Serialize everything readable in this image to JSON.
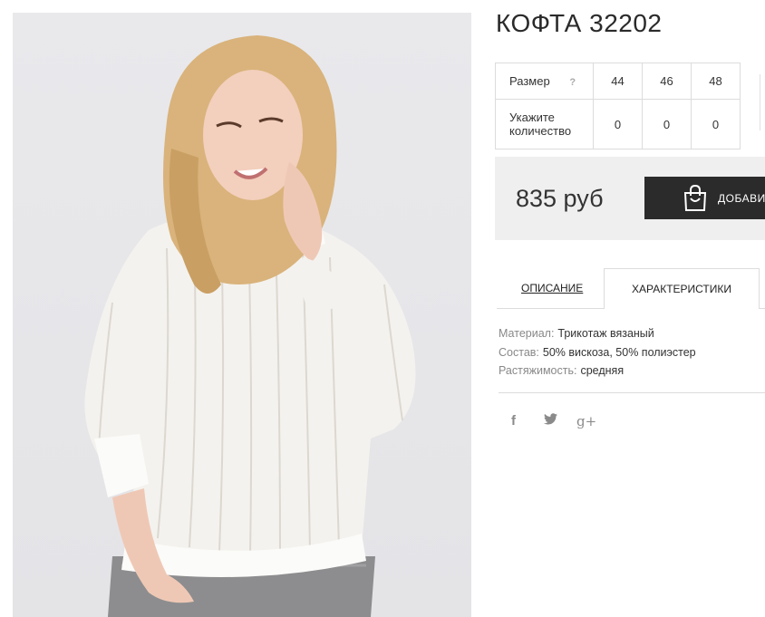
{
  "product": {
    "title": "КОФТА 32202",
    "image_alt": "Woman in white cable-knit sweater"
  },
  "sizes": {
    "label": "Размер",
    "help": "?",
    "values": [
      "44",
      "46",
      "48"
    ],
    "qty_label": "Укажите количество",
    "qty": [
      "0",
      "0",
      "0"
    ]
  },
  "purchase": {
    "price": "835 руб",
    "add_button": "ДОБАВИТЬ"
  },
  "tabs": {
    "description": "ОПИСАНИЕ",
    "characteristics": "ХАРАКТЕРИСТИКИ",
    "active": "characteristics"
  },
  "characteristics": [
    {
      "key": "Материал:",
      "value": "Трикотаж вязаный"
    },
    {
      "key": "Состав:",
      "value": "50% вискоза, 50% полиэстер"
    },
    {
      "key": "Растяжимость:",
      "value": "средняя"
    }
  ],
  "social": {
    "icons": [
      "facebook-icon",
      "twitter-icon",
      "google-plus-icon"
    ],
    "facebook": "f",
    "twitter": "t",
    "google": "g+"
  },
  "colors": {
    "button_bg": "#2b2b2b",
    "price_bg": "#efefef",
    "border": "#dcdcdc"
  }
}
